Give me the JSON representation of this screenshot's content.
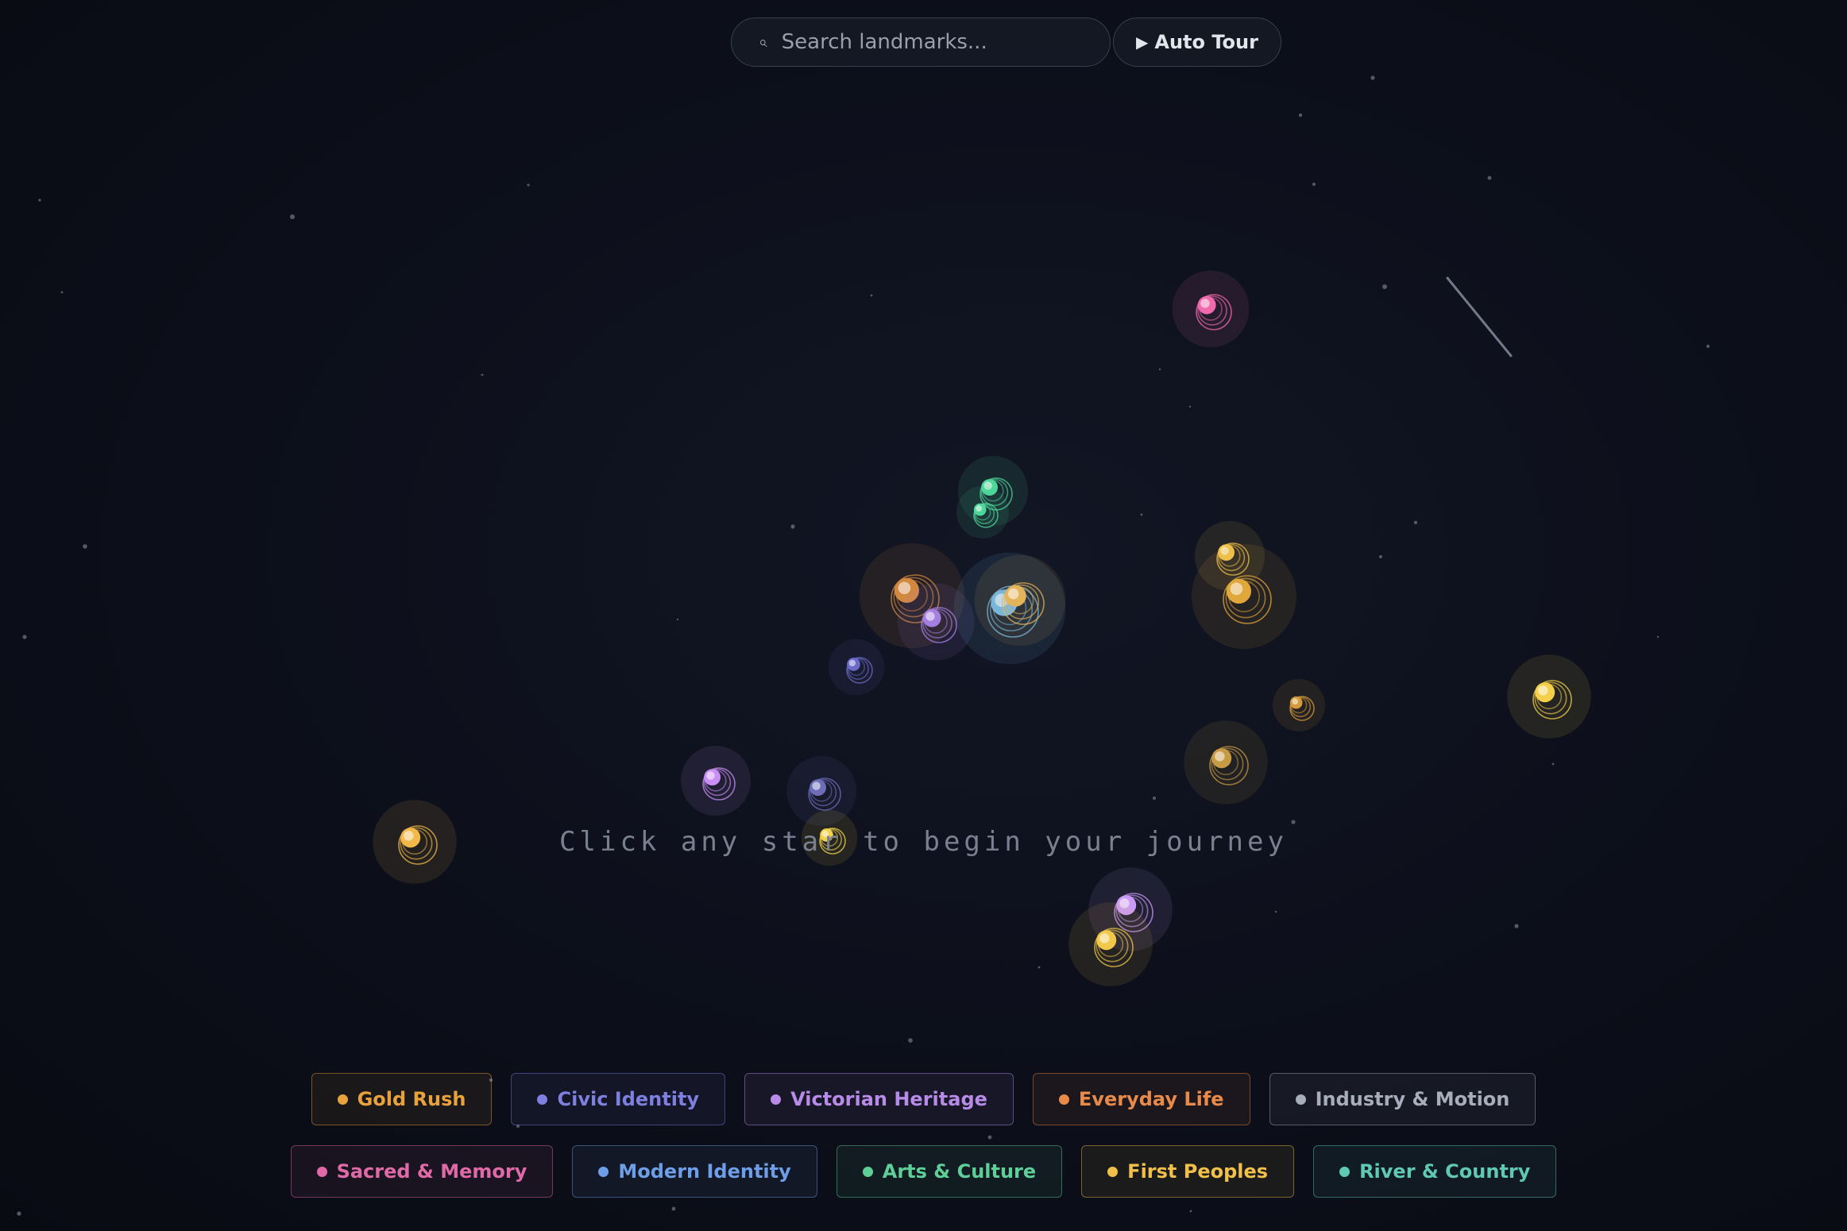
{
  "search": {
    "placeholder": "Search landmarks...",
    "icon": "search-icon"
  },
  "tour_button": {
    "label": "Auto Tour",
    "icon": "play-icon"
  },
  "hint": "Click any star to begin your journey",
  "categories_row1": [
    {
      "label": "Gold Rush",
      "color": "#e9a23b"
    },
    {
      "label": "Civic Identity",
      "color": "#7f7fe0"
    },
    {
      "label": "Victorian Heritage",
      "color": "#b98be8"
    },
    {
      "label": "Everyday Life",
      "color": "#e88a4a"
    },
    {
      "label": "Industry & Motion",
      "color": "#a7adbb"
    }
  ],
  "categories_row2": [
    {
      "label": "Sacred & Memory",
      "color": "#e06aa7"
    },
    {
      "label": "Modern Identity",
      "color": "#6f9ee8"
    },
    {
      "label": "Arts & Culture",
      "color": "#5fcf98"
    },
    {
      "label": "First Peoples",
      "color": "#f0c04a"
    },
    {
      "label": "River & Country",
      "color": "#5fc9b6"
    }
  ],
  "landmarks": [
    {
      "color": "#f06aae"
    },
    {
      "color": "#4fd69a"
    },
    {
      "color": "#4fd69a"
    },
    {
      "color": "#d2883f"
    },
    {
      "color": "#a57fe0"
    },
    {
      "color": "#6fb7e8"
    },
    {
      "color": "#e3b45a"
    },
    {
      "color": "#f0c24a"
    },
    {
      "color": "#e0a73b"
    },
    {
      "color": "#6a6ac8"
    },
    {
      "color": "#d49a3c"
    },
    {
      "color": "#f4d04a"
    },
    {
      "color": "#c79a45"
    },
    {
      "color": "#c98ff5"
    },
    {
      "color": "#6e6eb8"
    },
    {
      "color": "#f2b94a"
    },
    {
      "color": "#f3d24a"
    },
    {
      "color": "#c99af6"
    },
    {
      "color": "#f2c84a"
    }
  ]
}
